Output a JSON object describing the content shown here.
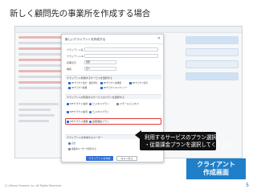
{
  "page": {
    "title": "新しく顧問先の事業所を作成する場合",
    "footer": "(C) Money Forward, Inc. All Rights Reserved.",
    "page_number": "5"
  },
  "modal": {
    "title": "新しいクライアントを作成する",
    "close_icon": "close-icon",
    "fields": [
      {
        "label": "クライアント名",
        "placeholder": ""
      },
      {
        "label": "クライアントID",
        "placeholder": ""
      }
    ],
    "select": {
      "label": "初期表示",
      "value": "選択"
    },
    "mode": {
      "label": "種別",
      "value": "法人"
    },
    "section_services_title": "クライアント利用するサービスを選択する",
    "service_checks": [
      "MFクラウド会計・確定申告",
      "MFクラウド請求書",
      "MFクラウド給与",
      "MFクラウド経費",
      "MFクラウドマイナンバー"
    ],
    "section_plans_title": "クライアントが利用するサービスのプランを選択する",
    "plans": [
      {
        "service": "MFクラウド会計",
        "option1": "ビジネスプラン",
        "option2": "スモールビジネス"
      },
      {
        "service": "MFクラウド給与",
        "option1": "ビジネスプラン",
        "option2": ""
      },
      {
        "service": "MFクラウド経費",
        "option1": "従量課金プラン",
        "option2": ""
      }
    ],
    "section_user_title": "クライアントを作成するユーザー",
    "user_options": [
      {
        "label": "自分",
        "selected": true
      },
      {
        "label": "事業者ユーザーを招待する",
        "selected": false
      }
    ],
    "submit_label": "クライアントを作成",
    "cancel_label": "キャンセル"
  },
  "callout": {
    "line1": "利用するサービスのプラン選択",
    "line2": "・従量課金プランを選択してください"
  },
  "badge": {
    "line1": "クライアント",
    "line2": "作成画面"
  },
  "colors": {
    "accent_blue": "#1f7fc8",
    "primary_button": "#2f6fd6",
    "highlight_red": "#e03a3a",
    "callout_bg": "#111111"
  }
}
